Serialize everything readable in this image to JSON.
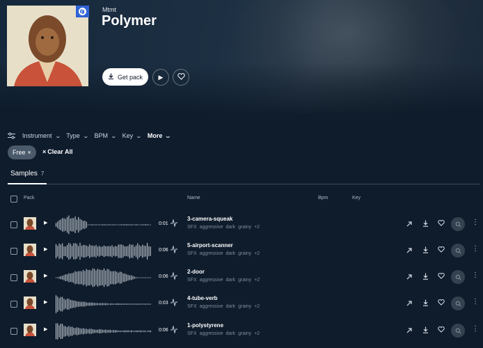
{
  "pack": {
    "artist": "Mtmt",
    "title": "Polymer",
    "get_pack_label": "Get pack"
  },
  "filters": [
    {
      "label": "Instrument",
      "chevron": "chevron-down-icon"
    },
    {
      "label": "Type",
      "chevron": "chevron-down-icon"
    },
    {
      "label": "BPM",
      "chevron": "chevron-down-icon"
    },
    {
      "label": "Key",
      "chevron": "chevron-down-icon"
    },
    {
      "label": "More",
      "chevron": "chevron-down-icon"
    }
  ],
  "active_filters": {
    "free_chip": "Free",
    "clear_all": "Clear All"
  },
  "tabs": [
    {
      "label": "Samples",
      "count": "7"
    }
  ],
  "table": {
    "columns": {
      "pack": "Pack",
      "name": "Name",
      "bpm": "Bpm",
      "key": "Key"
    },
    "rows": [
      {
        "name": "3-camera-squeak",
        "duration": "0:01",
        "tags": [
          "SFX",
          "aggressive",
          "dark",
          "grainy",
          "+2"
        ]
      },
      {
        "name": "5-airport-scanner",
        "duration": "0:06",
        "tags": [
          "SFX",
          "aggressive",
          "dark",
          "grainy",
          "+2"
        ]
      },
      {
        "name": "2-door",
        "duration": "0:06",
        "tags": [
          "SFX",
          "aggressive",
          "dark",
          "grainy",
          "+2"
        ]
      },
      {
        "name": "4-tube-verb",
        "duration": "0:03",
        "tags": [
          "SFX",
          "aggressive",
          "dark",
          "grainy",
          "+2"
        ]
      },
      {
        "name": "1-polystyrene",
        "duration": "0:06",
        "tags": [
          "SFX",
          "aggressive",
          "dark",
          "grainy",
          "+2"
        ]
      }
    ]
  },
  "colors": {
    "background": "#0f1c2c",
    "badge": "#2f63d6",
    "chip": "#4a5a6b"
  }
}
